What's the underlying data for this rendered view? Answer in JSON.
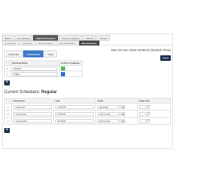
{
  "nav": {
    "top_tabs": [
      "Status",
      "Boot Settings",
      "Additional Features",
      "Advanced Settings",
      "Network",
      "Camera"
    ],
    "top_active": 2,
    "sub_tabs": [
      "Smartphone",
      "Schedules",
      "Bell Schedules",
      "Alert Notifications",
      "Bell Schedules"
    ],
    "sub_active": 4
  },
  "header": {
    "datetime": "Mon 20 Jun, 2016 22:08:10 (System Time)",
    "save_label": "Save"
  },
  "subtabs": {
    "items": [
      "Calendar",
      "Schedules",
      "Data"
    ],
    "active": 1
  },
  "schedules": {
    "col_name": "Schedule Name",
    "col_color": "Colour in Calendar",
    "rows": [
      {
        "name": "Regular",
        "color": "#5cb85c"
      },
      {
        "name": "Friday",
        "color": "#2b6fd6"
      }
    ]
  },
  "current": {
    "label": "Current Schedules:",
    "name": "Regular"
  },
  "items": {
    "col_description": "Description",
    "col_time": "Time",
    "col_audio": "Audio",
    "col_page_zone": "Page Zone",
    "rows": [
      {
        "description": "Lunch bell",
        "time": "12:00:00",
        "audio": "gong.wav",
        "zone": "1"
      },
      {
        "description": "recess start",
        "time": "10:00:00",
        "audio": "bell-no.wav",
        "zone": "1"
      },
      {
        "description": "recess finish",
        "time": "10:30:00",
        "audio": "bell-no.wav",
        "zone": "1"
      }
    ]
  },
  "icons": {
    "delete": "×",
    "add": "+",
    "play": "▶",
    "dropdown": "▼",
    "spin": "▲▼"
  }
}
